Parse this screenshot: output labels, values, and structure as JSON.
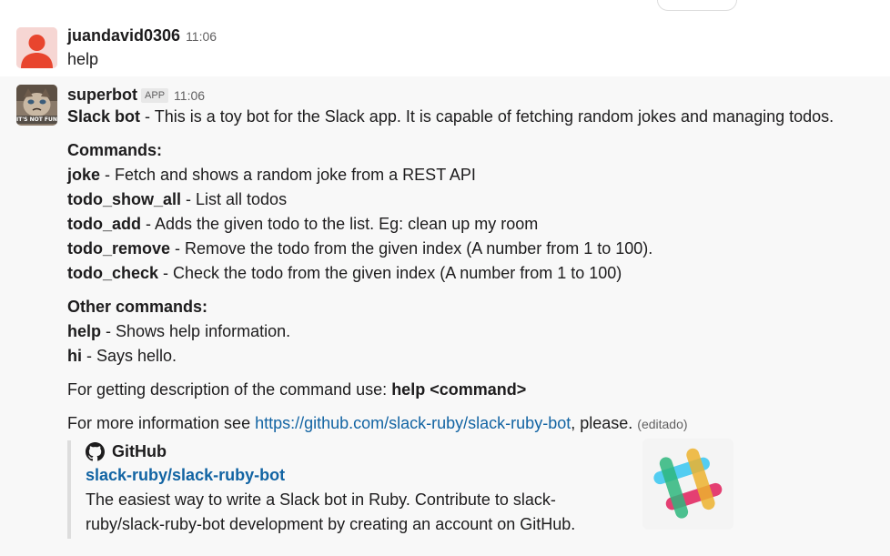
{
  "messages": [
    {
      "author": "juandavid0306",
      "time": "11:06",
      "text": "help"
    },
    {
      "author": "superbot",
      "badge": "APP",
      "time": "11:06",
      "avatar_caption": "IT'S NOT FUNNY",
      "intro": {
        "bold": "Slack bot",
        "rest": " - This is a toy bot for the Slack app. It is capable of fetching random jokes and managing todos."
      },
      "commands_heading": "Commands:",
      "commands": [
        {
          "name": "joke",
          "desc": " - Fetch and shows a random joke from a REST API"
        },
        {
          "name": "todo_show_all",
          "desc": " - List all todos"
        },
        {
          "name": "todo_add",
          "desc": " - Adds the given todo to the list. Eg: clean up my room"
        },
        {
          "name": "todo_remove",
          "desc": " - Remove the todo from the given index (A number from 1 to 100)."
        },
        {
          "name": "todo_check",
          "desc": " - Check the todo from the given index (A number from 1 to 100)"
        }
      ],
      "other_heading": "Other commands:",
      "other_commands": [
        {
          "name": "help",
          "desc": " - Shows help information."
        },
        {
          "name": "hi",
          "desc": " - Says hello."
        }
      ],
      "usage": {
        "text": "For getting description of the command use: ",
        "bold": "help <command>"
      },
      "more_info": {
        "prefix": "For more information see ",
        "link": "https://github.com/slack-ruby/slack-ruby-bot",
        "suffix": ", please.",
        "edited": "(editado)"
      },
      "attachment": {
        "service": "GitHub",
        "service_icon": "github-icon",
        "title": "slack-ruby/slack-ruby-bot",
        "description": "The easiest way to write a Slack bot in Ruby. Contribute to slack-ruby/slack-ruby-bot development by creating an account on GitHub."
      }
    }
  ],
  "colors": {
    "link": "#1264a3",
    "hover_bg": "#f8f8f8",
    "slack_blue": "#36c5f0",
    "slack_green": "#2eb67d",
    "slack_red": "#e01e5a",
    "slack_yellow": "#ecb22e"
  }
}
